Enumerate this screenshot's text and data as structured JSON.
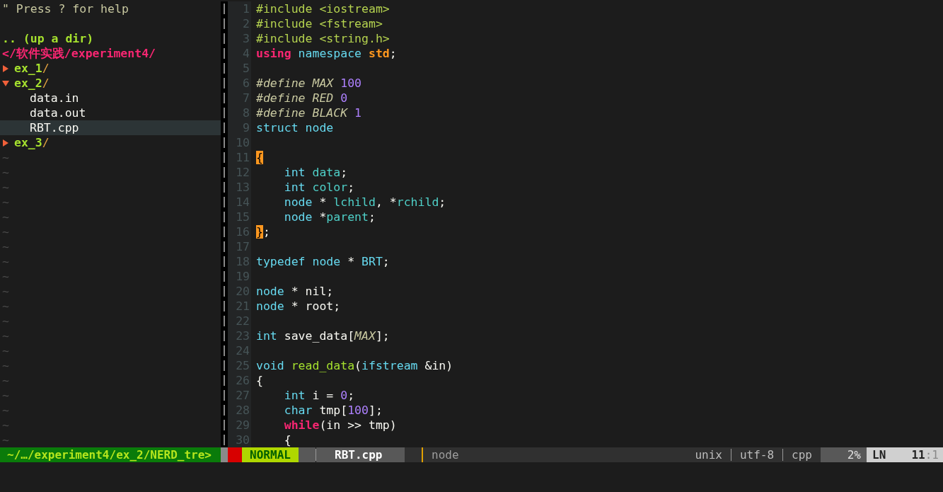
{
  "tree": {
    "help": "\" Press ? for help",
    "up": ".. (up a dir)",
    "root": "</软件实践/experiment4/",
    "items": [
      {
        "kind": "dir",
        "name": "ex_1",
        "suffix": "/",
        "expanded": false,
        "selected": false
      },
      {
        "kind": "dir",
        "name": "ex_2",
        "suffix": "/",
        "expanded": true,
        "selected": false,
        "children": [
          {
            "kind": "file",
            "name": "data.in",
            "selected": false
          },
          {
            "kind": "file",
            "name": "data.out",
            "selected": false
          },
          {
            "kind": "file",
            "name": "RBT.cpp",
            "selected": true
          }
        ]
      },
      {
        "kind": "dir",
        "name": "ex_3",
        "suffix": "/",
        "expanded": false,
        "selected": false
      }
    ],
    "filler": [
      "~",
      "~",
      "~",
      "~",
      "~",
      "~",
      "~",
      "~",
      "~",
      "~",
      "~",
      "~",
      "~",
      "~",
      "~",
      "~",
      "~",
      "~",
      "~",
      "~"
    ]
  },
  "editor": {
    "lines": [
      {
        "number": "1",
        "tokens": [
          {
            "kind": "pre",
            "text": "#include <iostream>"
          }
        ]
      },
      {
        "number": "2",
        "tokens": [
          {
            "kind": "pre",
            "text": "#include <fstream>"
          }
        ]
      },
      {
        "number": "3",
        "tokens": [
          {
            "kind": "pre",
            "text": "#include <string.h>"
          }
        ]
      },
      {
        "number": "4",
        "tokens": [
          {
            "kind": "kw",
            "text": "using"
          },
          {
            "kind": "type",
            "text": " namespace"
          },
          {
            "kind": "ns",
            "text": " std"
          },
          {
            "kind": "plain",
            "text": ";"
          }
        ]
      },
      {
        "number": "5"
      },
      {
        "number": "6",
        "tokens": [
          {
            "kind": "macro",
            "text": "#define MAX"
          },
          {
            "kind": "num",
            "text": " 100"
          }
        ]
      },
      {
        "number": "7",
        "tokens": [
          {
            "kind": "macro",
            "text": "#define RED"
          },
          {
            "kind": "num",
            "text": " 0"
          }
        ]
      },
      {
        "number": "8",
        "tokens": [
          {
            "kind": "macro",
            "text": "#define BLACK"
          },
          {
            "kind": "num",
            "text": " 1"
          }
        ]
      },
      {
        "number": "9",
        "tokens": [
          {
            "kind": "type",
            "text": "struct node"
          }
        ]
      },
      {
        "number": "10"
      },
      {
        "number": "11",
        "tokens": [
          {
            "kind": "match",
            "text": "{"
          }
        ]
      },
      {
        "number": "12",
        "tokens": [
          {
            "kind": "type",
            "text": "    int"
          },
          {
            "kind": "member",
            "text": " data"
          },
          {
            "kind": "plain",
            "text": ";"
          }
        ]
      },
      {
        "number": "13",
        "tokens": [
          {
            "kind": "type",
            "text": "    int"
          },
          {
            "kind": "member",
            "text": " color"
          },
          {
            "kind": "plain",
            "text": ";"
          }
        ]
      },
      {
        "number": "14",
        "tokens": [
          {
            "kind": "type",
            "text": "    node"
          },
          {
            "kind": "plain",
            "text": " *"
          },
          {
            "kind": "member",
            "text": " lchild"
          },
          {
            "kind": "plain",
            "text": ", *"
          },
          {
            "kind": "member",
            "text": "rchild"
          },
          {
            "kind": "plain",
            "text": ";"
          }
        ]
      },
      {
        "number": "15",
        "tokens": [
          {
            "kind": "type",
            "text": "    node"
          },
          {
            "kind": "plain",
            "text": " *"
          },
          {
            "kind": "member",
            "text": "parent"
          },
          {
            "kind": "plain",
            "text": ";"
          }
        ]
      },
      {
        "number": "16",
        "tokens": [
          {
            "kind": "match",
            "text": "}"
          },
          {
            "kind": "plain",
            "text": ";"
          }
        ]
      },
      {
        "number": "17"
      },
      {
        "number": "18",
        "tokens": [
          {
            "kind": "type",
            "text": "typedef node"
          },
          {
            "kind": "plain",
            "text": " *"
          },
          {
            "kind": "type",
            "text": " BRT"
          },
          {
            "kind": "plain",
            "text": ";"
          }
        ]
      },
      {
        "number": "19"
      },
      {
        "number": "20",
        "tokens": [
          {
            "kind": "type",
            "text": "node"
          },
          {
            "kind": "plain",
            "text": " * nil;"
          }
        ]
      },
      {
        "number": "21",
        "tokens": [
          {
            "kind": "type",
            "text": "node"
          },
          {
            "kind": "plain",
            "text": " * root;"
          }
        ]
      },
      {
        "number": "22"
      },
      {
        "number": "23",
        "tokens": [
          {
            "kind": "type",
            "text": "int"
          },
          {
            "kind": "plain",
            "text": " save_data["
          },
          {
            "kind": "macro",
            "text": "MAX"
          },
          {
            "kind": "plain",
            "text": "];"
          }
        ]
      },
      {
        "number": "24"
      },
      {
        "number": "25",
        "tokens": [
          {
            "kind": "type",
            "text": "void"
          },
          {
            "kind": "func",
            "text": " read_data"
          },
          {
            "kind": "plain",
            "text": "("
          },
          {
            "kind": "type",
            "text": "ifstream"
          },
          {
            "kind": "plain",
            "text": " &in)"
          }
        ]
      },
      {
        "number": "26",
        "tokens": [
          {
            "kind": "plain",
            "text": "{"
          }
        ]
      },
      {
        "number": "27",
        "tokens": [
          {
            "kind": "type",
            "text": "    int"
          },
          {
            "kind": "plain",
            "text": " i ="
          },
          {
            "kind": "num",
            "text": " 0"
          },
          {
            "kind": "plain",
            "text": ";"
          }
        ]
      },
      {
        "number": "28",
        "tokens": [
          {
            "kind": "type",
            "text": "    char"
          },
          {
            "kind": "plain",
            "text": " tmp["
          },
          {
            "kind": "num",
            "text": "100"
          },
          {
            "kind": "plain",
            "text": "];"
          }
        ]
      },
      {
        "number": "29",
        "tokens": [
          {
            "kind": "kw",
            "text": "    while"
          },
          {
            "kind": "plain",
            "text": "(in >> tmp)"
          }
        ]
      },
      {
        "number": "30",
        "tokens": [
          {
            "kind": "plain",
            "text": "    {"
          }
        ]
      }
    ]
  },
  "status_bar": {
    "path": "~/…/experiment4/ex_2/NERD_tre>",
    "mode": "NORMAL",
    "file": "RBT.cpp",
    "function": "node",
    "fileformat": "unix",
    "encoding": "utf-8",
    "filetype": "cpp",
    "percent": "2%",
    "position_label": "LN",
    "line": "11",
    "column": ":1"
  }
}
